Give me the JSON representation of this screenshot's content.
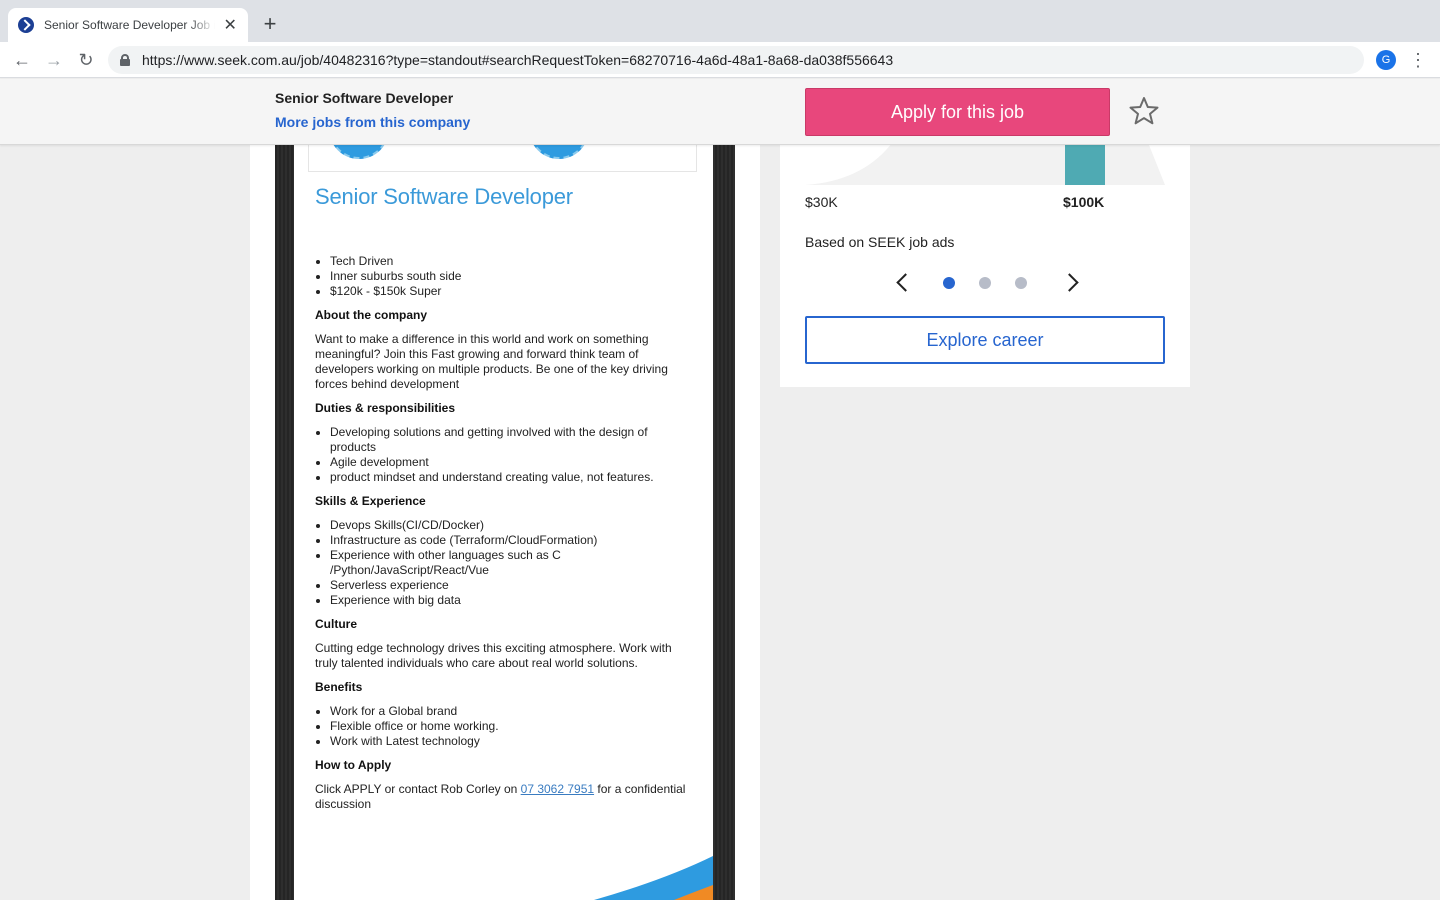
{
  "browser": {
    "tab_title": "Senior Software Developer Job in",
    "tab_close": "✕",
    "new_tab": "+",
    "url": "https://www.seek.com.au/job/40482316?type=standout#searchRequestToken=68270716-4a6d-48a1-8a68-da038f556643",
    "profile_initial": "G",
    "menu": "⋮",
    "back": "←",
    "forward": "→",
    "reload": "↻"
  },
  "sticky_header": {
    "job_title": "Senior Software Developer",
    "more_jobs_link": "More jobs from this company",
    "apply_button": "Apply for this job"
  },
  "job_ad": {
    "title": "Senior Software Developer",
    "highlights": [
      "Tech Driven",
      "Inner suburbs south side",
      "$120k - $150k Super"
    ],
    "about_heading": "About the company",
    "about_text": "Want to make a difference in this world and work on something meaningful? Join this Fast growing and forward think team of developers working on multiple products. Be one of the key driving forces behind development",
    "duties_heading": "Duties & responsibilities",
    "duties": [
      "Developing solutions and getting involved with the design of products",
      "Agile development",
      "product mindset and understand creating value, not features."
    ],
    "skills_heading": "Skills & Experience",
    "skills": [
      "Devops Skills(CI/CD/Docker)",
      "Infrastructure as code (Terraform/CloudFormation)",
      "Experience with other languages such as C /Python/JavaScript/React/Vue",
      "Serverless experience",
      "Experience with big data"
    ],
    "culture_heading": "Culture",
    "culture_text": "Cutting edge technology drives this exciting atmosphere. Work with truly talented individuals who care about real world solutions.",
    "benefits_heading": "Benefits",
    "benefits": [
      "Work for a Global brand",
      "Flexible office or home working.",
      "Work with Latest technology"
    ],
    "apply_heading": "How to Apply",
    "apply_text_before": "Click APPLY or contact Rob Corley on ",
    "apply_phone": "07 3062 7951",
    "apply_text_after": " for a confidential discussion"
  },
  "salary_panel": {
    "low_label": "$30K",
    "high_label": "$100K",
    "source_text": "Based on SEEK job ads",
    "carousel_pages": 3,
    "carousel_active": 1,
    "explore_button": "Explore career",
    "bar_color": "#4faab3",
    "curve_color": "#f2f2f2"
  },
  "colors": {
    "apply": "#e8477c",
    "link": "#2765cf",
    "ad_title": "#3b9ad9"
  }
}
